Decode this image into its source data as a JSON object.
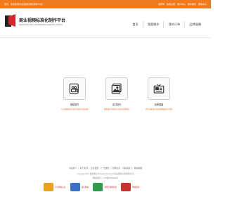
{
  "topbar": {
    "notice": "您好，欢迎使用商业视频标准化制作平台！",
    "links": [
      "请登录",
      "免费注册",
      "用户中心",
      "制作服务",
      "帮助中心"
    ]
  },
  "brand": {
    "name_cn": "商业视频标准化制作平台",
    "name_en": "Commercial video standardization production platform",
    "colors": {
      "accent": "#f07a1e",
      "logo_red": "#d4262c"
    }
  },
  "nav": {
    "items": [
      "首页",
      "我要制作",
      "我的订单",
      "品牌展播"
    ]
  },
  "services": [
    {
      "icon": "video-camera-icon",
      "title": "视频制作",
      "desc": "专业拍摄团队为您打造商业宣传视频"
    },
    {
      "icon": "image-gallery-icon",
      "title": "素材制作",
      "desc": "精美图片素材设计为您的品牌增色"
    },
    {
      "icon": "broadcast-screen-icon",
      "title": "品牌展播",
      "desc": "多平台展播让您的品牌被更多人看到"
    }
  ],
  "footer": {
    "links": [
      "平台简介",
      "关于我们",
      "业务范围",
      "广告服务",
      "招聘信息",
      "联系我们",
      "网站地图"
    ],
    "copyright": "Copyright 2016 金鹿科技 All Rights Reserved  商业视频标准化制作平台",
    "icp": "网站备案号：ICP备00000000号",
    "badges": [
      "可信网站认证",
      "诚信网站",
      "中国互联网协会",
      "网络警察"
    ]
  }
}
